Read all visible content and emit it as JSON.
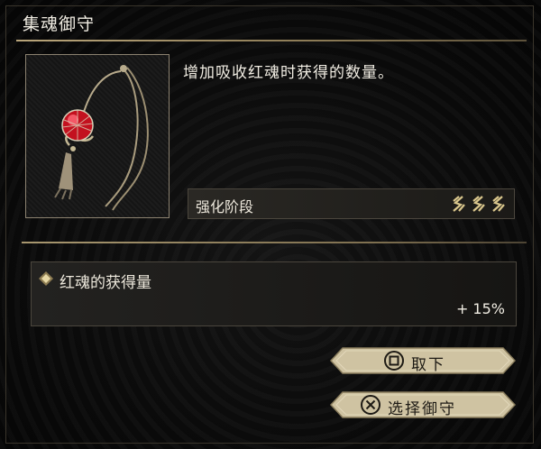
{
  "panel": {
    "title": "集魂御守",
    "description": "增加吸收红魂时获得的数量。"
  },
  "upgrade": {
    "label": "强化阶段",
    "level": 3,
    "max_level": 3
  },
  "stat": {
    "label": "红魂的获得量",
    "value": "+ 15%"
  },
  "buttons": {
    "remove": {
      "icon": "square-button-icon",
      "label": "取下"
    },
    "select": {
      "icon": "cross-button-icon",
      "label": "选择御守"
    }
  },
  "colors": {
    "gold_rule": "#b9a57a",
    "button_fill": "#cfc3a2",
    "gem_red": "#d0142a"
  }
}
